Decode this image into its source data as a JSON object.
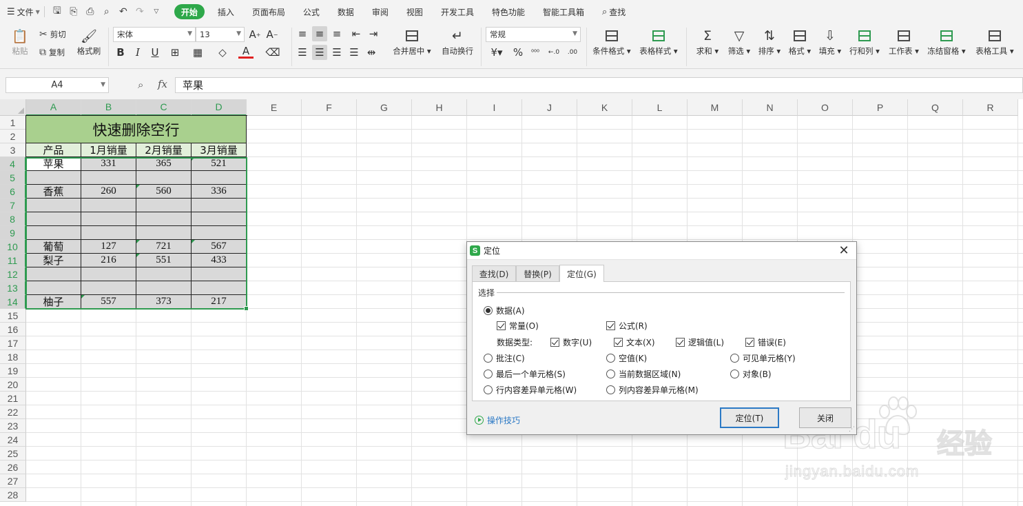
{
  "menubar": {
    "file_label": "文件",
    "tabs": [
      "开始",
      "插入",
      "页面布局",
      "公式",
      "数据",
      "审阅",
      "视图",
      "开发工具",
      "特色功能",
      "智能工具箱"
    ],
    "search_label": "查找"
  },
  "ribbon": {
    "paste": "粘贴",
    "cut": "剪切",
    "copy": "复制",
    "format_painter": "格式刷",
    "font_name": "宋体",
    "font_size": "13",
    "merge_center": "合并居中",
    "wrap_text": "自动换行",
    "number_format": "常规",
    "conditional_format": "条件格式",
    "table_style": "表格样式",
    "sum": "求和",
    "filter": "筛选",
    "sort": "排序",
    "format": "格式",
    "fill": "填充",
    "row_col": "行和列",
    "worksheet": "工作表",
    "freeze": "冻结窗格",
    "table_tools": "表格工具"
  },
  "formula_bar": {
    "name_box": "A4",
    "fx": "fx",
    "content": "苹果"
  },
  "columns": [
    "A",
    "B",
    "C",
    "D",
    "E",
    "F",
    "G",
    "H",
    "I",
    "J",
    "K",
    "L",
    "M",
    "N",
    "O",
    "P",
    "Q",
    "R"
  ],
  "rows": [
    "1",
    "2",
    "3",
    "4",
    "5",
    "6",
    "7",
    "8",
    "9",
    "10",
    "11",
    "12",
    "13",
    "14",
    "15",
    "16",
    "17",
    "18",
    "19",
    "20",
    "21",
    "22",
    "23",
    "24",
    "25",
    "26",
    "27",
    "28"
  ],
  "table": {
    "title": "快速删除空行",
    "headers": [
      "产品",
      "1月销量",
      "2月销量",
      "3月销量"
    ],
    "rows": [
      [
        "苹果",
        "331",
        "365",
        "521"
      ],
      [
        "",
        "",
        "",
        ""
      ],
      [
        "香蕉",
        "260",
        "560",
        "336"
      ],
      [
        "",
        "",
        "",
        ""
      ],
      [
        "",
        "",
        "",
        ""
      ],
      [
        "",
        "",
        "",
        ""
      ],
      [
        "葡萄",
        "127",
        "721",
        "567"
      ],
      [
        "梨子",
        "216",
        "551",
        "433"
      ],
      [
        "",
        "",
        "",
        ""
      ],
      [
        "",
        "",
        "",
        ""
      ],
      [
        "柚子",
        "557",
        "373",
        "217"
      ]
    ]
  },
  "dialog": {
    "logo": "S",
    "title": "定位",
    "tabs": [
      "查找(D)",
      "替换(P)",
      "定位(G)"
    ],
    "group_label": "选择",
    "data_option": "数据(A)",
    "constants": "常量(O)",
    "formulas": "公式(R)",
    "data_types_label": "数据类型:",
    "types": [
      "数字(U)",
      "文本(X)",
      "逻辑值(L)",
      "错误(E)"
    ],
    "options": [
      "批注(C)",
      "空值(K)",
      "可见单元格(Y)",
      "最后一个单元格(S)",
      "当前数据区域(N)",
      "对象(B)",
      "行内容差异单元格(W)",
      "列内容差异单元格(M)"
    ],
    "tips": "操作技巧",
    "locate_button": "定位(T)",
    "close_button": "关闭"
  },
  "watermark": {
    "brand": "Bai du",
    "cn": "经验",
    "url": "jingyan.baidu.com"
  }
}
